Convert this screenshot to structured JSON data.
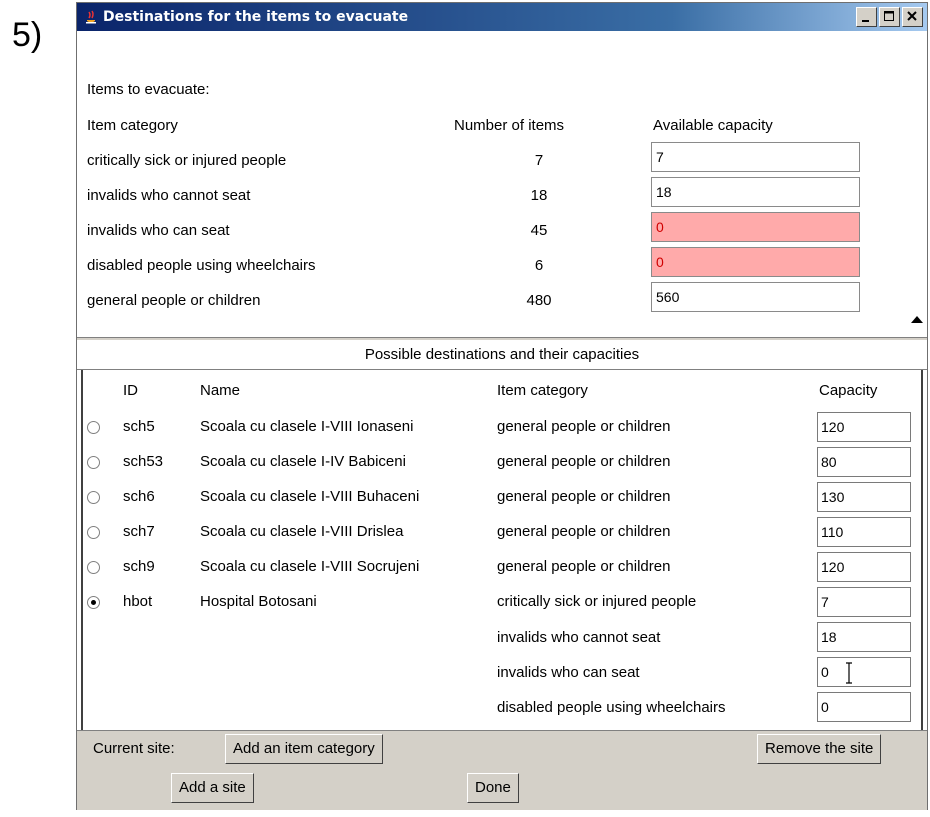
{
  "step_label": "5)",
  "window": {
    "title": "Destinations for the items to evacuate"
  },
  "items_section": {
    "heading": "Items to evacuate:",
    "columns": {
      "category": "Item category",
      "number": "Number of items",
      "capacity": "Available capacity"
    },
    "rows": [
      {
        "category": "critically sick or injured people",
        "number": "7",
        "capacity": "7",
        "insufficient": false
      },
      {
        "category": "invalids who cannot seat",
        "number": "18",
        "capacity": "18",
        "insufficient": false
      },
      {
        "category": "invalids who can seat",
        "number": "45",
        "capacity": "0",
        "insufficient": true
      },
      {
        "category": "disabled people using wheelchairs",
        "number": "6",
        "capacity": "0",
        "insufficient": true
      },
      {
        "category": "general people or children",
        "number": "480",
        "capacity": "560",
        "insufficient": false
      }
    ]
  },
  "destinations": {
    "heading": "Possible destinations and their capacities",
    "columns": {
      "id": "ID",
      "name": "Name",
      "category": "Item category",
      "capacity": "Capacity"
    },
    "rows": [
      {
        "id": "sch5",
        "name": "Scoala cu clasele I-VIII Ionaseni",
        "category": "general people or children",
        "capacity": "120",
        "selected": false
      },
      {
        "id": "sch53",
        "name": "Scoala cu clasele I-IV Babiceni",
        "category": "general people or children",
        "capacity": "80",
        "selected": false
      },
      {
        "id": "sch6",
        "name": "Scoala cu clasele I-VIII Buhaceni",
        "category": "general people or children",
        "capacity": "130",
        "selected": false
      },
      {
        "id": "sch7",
        "name": "Scoala cu clasele I-VIII Drislea",
        "category": "general people or children",
        "capacity": "110",
        "selected": false
      },
      {
        "id": "sch9",
        "name": "Scoala cu clasele I-VIII Socrujeni",
        "category": "general people or children",
        "capacity": "120",
        "selected": false
      },
      {
        "id": "hbot",
        "name": "Hospital Botosani",
        "category": "critically sick or injured people",
        "capacity": "7",
        "selected": true
      },
      {
        "id": "",
        "name": "",
        "category": "invalids who cannot seat",
        "capacity": "18",
        "selected": null
      },
      {
        "id": "",
        "name": "",
        "category": "invalids who can seat",
        "capacity": "0",
        "selected": null
      },
      {
        "id": "",
        "name": "",
        "category": "disabled people using wheelchairs",
        "capacity": "0",
        "selected": null
      }
    ]
  },
  "bottom_bar": {
    "current_site_label": "Current site:",
    "add_category_button": "Add an item category",
    "remove_site_button": "Remove the site",
    "add_site_button": "Add a site",
    "done_button": "Done"
  },
  "colors": {
    "insufficient_bg": "#ffaaaa",
    "insufficient_text": "#d00000",
    "titlebar_start": "#0a246a",
    "button_face": "#d4d0c8"
  }
}
